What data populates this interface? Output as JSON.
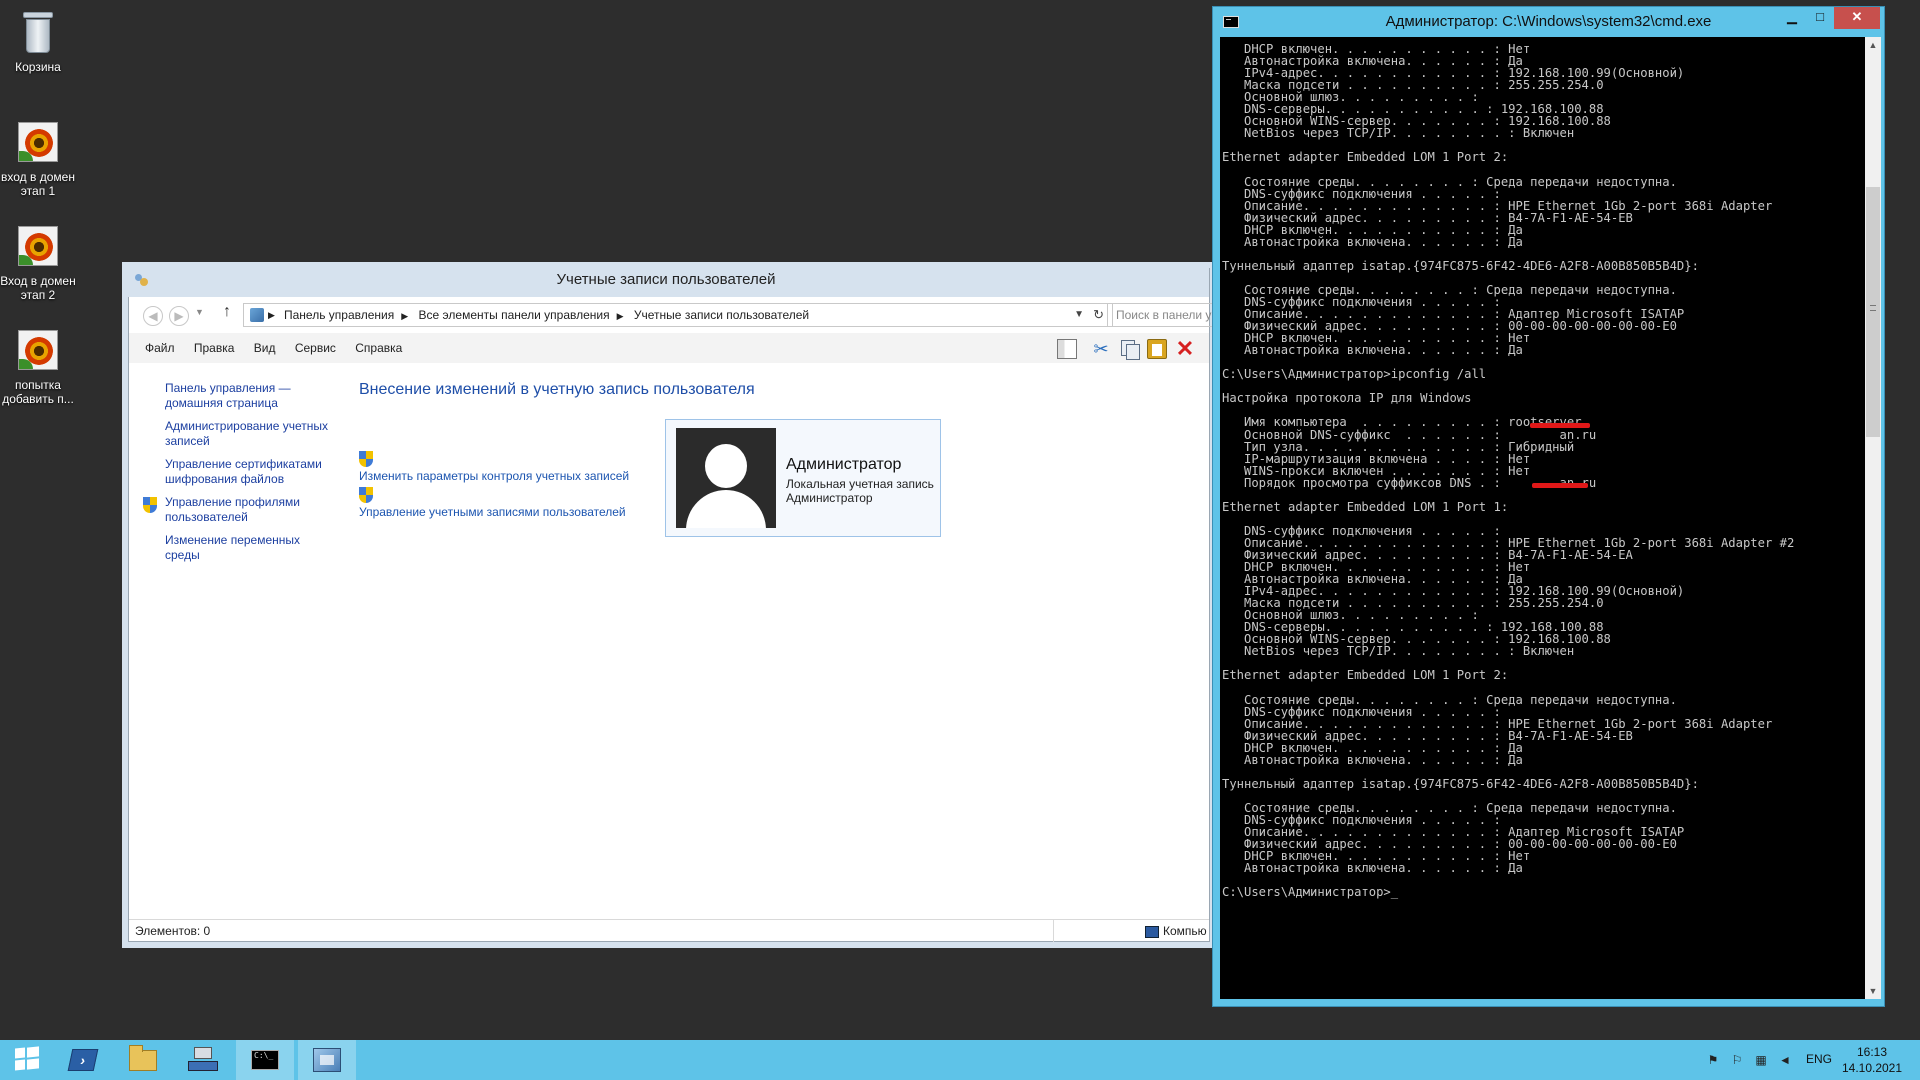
{
  "desktop": {
    "icons": [
      {
        "label": "Корзина",
        "icon": "recycle-bin-icon"
      },
      {
        "label": "вход в домен этап 1",
        "icon": "shortcut-icon"
      },
      {
        "label": "Вход в домен этап 2",
        "icon": "shortcut-icon"
      },
      {
        "label": "попытка добавить п...",
        "icon": "shortcut-icon"
      }
    ]
  },
  "explorer": {
    "title": "Учетные записи пользователей",
    "address": {
      "crumbs": [
        "Панель управления",
        "Все элементы панели управления",
        "Учетные записи пользователей"
      ]
    },
    "search_placeholder": "Поиск в панели у",
    "menu": [
      "Файл",
      "Правка",
      "Вид",
      "Сервис",
      "Справка"
    ],
    "left_nav": [
      "Панель управления — домашняя страница",
      "Администрирование учетных записей",
      "Управление сертификатами шифрования файлов",
      "Управление профилями пользователей",
      "Изменение переменных среды"
    ],
    "heading": "Внесение изменений в учетную запись пользователя",
    "tasks": [
      "Изменить параметры контроля учетных записей",
      "Управление учетными записями пользователей"
    ],
    "user": {
      "name": "Администратор",
      "type": "Локальная учетная запись",
      "group": "Администратор"
    },
    "status": {
      "items": "Элементов: 0",
      "location": "Компью"
    }
  },
  "cmd": {
    "title": "Администратор: C:\\Windows\\system32\\cmd.exe",
    "buttons": {
      "minimize": "▁",
      "maximize": "□",
      "close": "✕"
    },
    "lines": [
      "   DHCP включен. . . . . . . . . . . : Нет",
      "   Автонастройка включена. . . . . . : Да",
      "   IPv4-адрес. . . . . . . . . . . . : 192.168.100.99(Основной)",
      "   Маска подсети . . . . . . . . . . : 255.255.254.0",
      "   Основной шлюз. . . . . . . . . :",
      "   DNS-серверы. . . . . . . . . . . : 192.168.100.88",
      "   Основной WINS-сервер. . . . . . . : 192.168.100.88",
      "   NetBios через TCP/IP. . . . . . . . : Включен",
      "",
      "Ethernet adapter Embedded LOM 1 Port 2:",
      "",
      "   Состояние среды. . . . . . . . : Среда передачи недоступна.",
      "   DNS-суффикс подключения . . . . . :",
      "   Описание. . . . . . . . . . . . . : HPE Ethernet 1Gb 2-port 368i Adapter",
      "   Физический адрес. . . . . . . . . : B4-7A-F1-AE-54-EB",
      "   DHCP включен. . . . . . . . . . . : Да",
      "   Автонастройка включена. . . . . . : Да",
      "",
      "Туннельный адаптер isatap.{974FC875-6F42-4DE6-A2F8-A00B850B5B4D}:",
      "",
      "   Состояние среды. . . . . . . . : Среда передачи недоступна.",
      "   DNS-суффикс подключения . . . . . :",
      "   Описание. . . . . . . . . . . . . : Адаптер Microsoft ISATAP",
      "   Физический адрес. . . . . . . . . : 00-00-00-00-00-00-00-E0",
      "   DHCP включен. . . . . . . . . . . : Нет",
      "   Автонастройка включена. . . . . . : Да",
      "",
      "C:\\Users\\Администратор>ipconfig /all",
      "",
      "Настройка протокола IP для Windows",
      "",
      "   Имя компьютера  . . . . . . . . . : rootserver",
      "   Основной DNS-суффикс  . . . . . . :        an.ru",
      "   Тип узла. . . . . . . . . . . . . : Гибридный",
      "   IP-маршрутизация включена . . . . : Нет",
      "   WINS-прокси включен . . . . . . . : Нет",
      "   Порядок просмотра суффиксов DNS . :        an.ru",
      "",
      "Ethernet adapter Embedded LOM 1 Port 1:",
      "",
      "   DNS-суффикс подключения . . . . . :",
      "   Описание. . . . . . . . . . . . . : HPE Ethernet 1Gb 2-port 368i Adapter #2",
      "   Физический адрес. . . . . . . . . : B4-7A-F1-AE-54-EA",
      "   DHCP включен. . . . . . . . . . . : Нет",
      "   Автонастройка включена. . . . . . : Да",
      "   IPv4-адрес. . . . . . . . . . . . : 192.168.100.99(Основной)",
      "   Маска подсети . . . . . . . . . . : 255.255.254.0",
      "   Основной шлюз. . . . . . . . . :",
      "   DNS-серверы. . . . . . . . . . . : 192.168.100.88",
      "   Основной WINS-сервер. . . . . . . : 192.168.100.88",
      "   NetBios через TCP/IP. . . . . . . . : Включен",
      "",
      "Ethernet adapter Embedded LOM 1 Port 2:",
      "",
      "   Состояние среды. . . . . . . . : Среда передачи недоступна.",
      "   DNS-суффикс подключения . . . . . :",
      "   Описание. . . . . . . . . . . . . : HPE Ethernet 1Gb 2-port 368i Adapter",
      "   Физический адрес. . . . . . . . . : B4-7A-F1-AE-54-EB",
      "   DHCP включен. . . . . . . . . . . : Да",
      "   Автонастройка включена. . . . . . : Да",
      "",
      "Туннельный адаптер isatap.{974FC875-6F42-4DE6-A2F8-A00B850B5B4D}:",
      "",
      "   Состояние среды. . . . . . . . : Среда передачи недоступна.",
      "   DNS-суффикс подключения . . . . . :",
      "   Описание. . . . . . . . . . . . . : Адаптер Microsoft ISATAP",
      "   Физический адрес. . . . . . . . . : 00-00-00-00-00-00-00-E0",
      "   DHCP включен. . . . . . . . . . . : Нет",
      "   Автонастройка включена. . . . . . : Да",
      "",
      "C:\\Users\\Администратор>_"
    ]
  },
  "taskbar": {
    "apps": [
      "start-button",
      "powershell",
      "file-explorer",
      "server-manager",
      "cmd",
      "control-panel"
    ],
    "lang": "ENG",
    "time": "16:13",
    "date": "14.10.2021"
  },
  "colors": {
    "taskbar": "#5ec3e8",
    "desktop": "#2d2d2d",
    "link": "#1c55b0",
    "redaction": "#e01818"
  }
}
